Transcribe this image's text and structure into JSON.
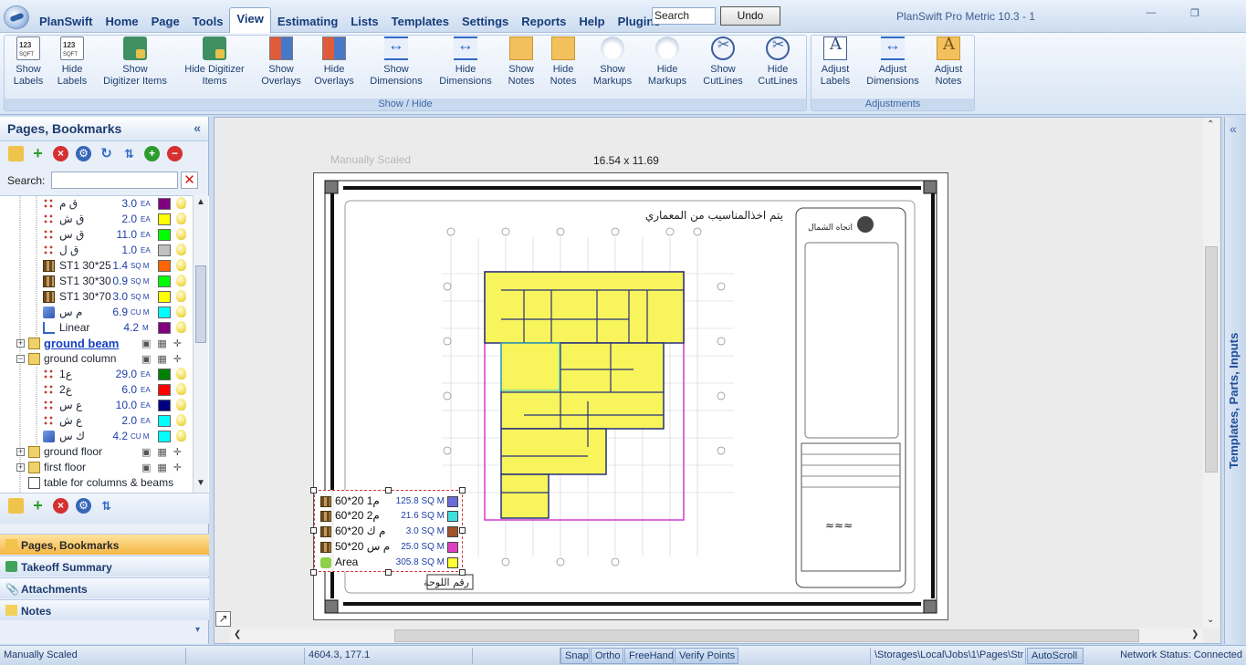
{
  "menubar": {
    "items": [
      "PlanSwift",
      "Home",
      "Page",
      "Tools",
      "View",
      "Estimating",
      "Lists",
      "Templates",
      "Settings",
      "Reports",
      "Help",
      "Plugins"
    ],
    "active_index": 4,
    "search_value": "Search",
    "undo_label": "Undo",
    "window_title": "PlanSwift Pro Metric 10.3 - 1"
  },
  "ribbon": {
    "show_hide_caption": "Show / Hide",
    "adjustments_caption": "Adjustments",
    "buttons": [
      {
        "l1": "Show",
        "l2": "Labels",
        "icon": "show-labels-icon"
      },
      {
        "l1": "Hide",
        "l2": "Labels",
        "icon": "hide-labels-icon"
      },
      {
        "l1": "Show",
        "l2": "Digitizer Items",
        "icon": "show-digitizer-icon"
      },
      {
        "l1": "Hide Digitizer",
        "l2": "Items",
        "icon": "hide-digitizer-icon"
      },
      {
        "l1": "Show",
        "l2": "Overlays",
        "icon": "show-overlays-icon"
      },
      {
        "l1": "Hide",
        "l2": "Overlays",
        "icon": "hide-overlays-icon"
      },
      {
        "l1": "Show",
        "l2": "Dimensions",
        "icon": "show-dimensions-icon"
      },
      {
        "l1": "Hide",
        "l2": "Dimensions",
        "icon": "hide-dimensions-icon"
      },
      {
        "l1": "Show",
        "l2": "Notes",
        "icon": "show-notes-icon"
      },
      {
        "l1": "Hide",
        "l2": "Notes",
        "icon": "hide-notes-icon"
      },
      {
        "l1": "Show",
        "l2": "Markups",
        "icon": "show-markups-icon"
      },
      {
        "l1": "Hide",
        "l2": "Markups",
        "icon": "hide-markups-icon"
      },
      {
        "l1": "Show",
        "l2": "CutLines",
        "icon": "show-cutlines-icon"
      },
      {
        "l1": "Hide",
        "l2": "CutLines",
        "icon": "hide-cutlines-icon"
      },
      {
        "l1": "Adjust",
        "l2": "Labels",
        "icon": "adjust-labels-icon"
      },
      {
        "l1": "Adjust",
        "l2": "Dimensions",
        "icon": "adjust-dimensions-icon"
      },
      {
        "l1": "Adjust",
        "l2": "Notes",
        "icon": "adjust-notes-icon"
      }
    ]
  },
  "left_panel": {
    "title": "Pages, Bookmarks",
    "collapse": "«",
    "search_label": "Search:",
    "tree": [
      {
        "name": "ق م",
        "qty": "3.0",
        "unit": "EA",
        "color": "#800080",
        "icon": "count"
      },
      {
        "name": "ق ش",
        "qty": "2.0",
        "unit": "EA",
        "color": "#ffff00",
        "icon": "count"
      },
      {
        "name": "ق س",
        "qty": "11.0",
        "unit": "EA",
        "color": "#00ff00",
        "icon": "count"
      },
      {
        "name": "ق ل",
        "qty": "1.0",
        "unit": "EA",
        "color": "#c0c0c0",
        "icon": "count"
      },
      {
        "name": "ST1 30*25",
        "qty": "1.4",
        "unit": "SQ M",
        "color": "#ff6600",
        "icon": "area"
      },
      {
        "name": "ST1 30*30",
        "qty": "0.9",
        "unit": "SQ M",
        "color": "#00ff00",
        "icon": "area"
      },
      {
        "name": "ST1 30*70",
        "qty": "3.0",
        "unit": "SQ M",
        "color": "#ffff00",
        "icon": "area"
      },
      {
        "name": "م س",
        "qty": "6.9",
        "unit": "CU M",
        "color": "#00ffff",
        "icon": "volume"
      },
      {
        "name": "Linear",
        "qty": "4.2",
        "unit": "M",
        "color": "#800080",
        "icon": "linear"
      },
      {
        "name": "ground beam",
        "folder": true
      },
      {
        "name": "ground column",
        "folder": true,
        "expanded": true
      },
      {
        "name": "ع1",
        "qty": "29.0",
        "unit": "EA",
        "color": "#008000",
        "icon": "count"
      },
      {
        "name": "ع2",
        "qty": "6.0",
        "unit": "EA",
        "color": "#ff0000",
        "icon": "count"
      },
      {
        "name": "ع س",
        "qty": "10.0",
        "unit": "EA",
        "color": "#000080",
        "icon": "count"
      },
      {
        "name": "ع ش",
        "qty": "2.0",
        "unit": "EA",
        "color": "#00ffff",
        "icon": "count"
      },
      {
        "name": "ك س",
        "qty": "4.2",
        "unit": "CU M",
        "color": "#00ffff",
        "icon": "volume"
      },
      {
        "name": "ground floor",
        "folder": true
      },
      {
        "name": "first floor",
        "folder": true
      },
      {
        "name": "table for columns & beams",
        "page": true
      }
    ],
    "nav": [
      {
        "label": "Pages, Bookmarks",
        "active": true
      },
      {
        "label": "Takeoff Summary"
      },
      {
        "label": "Attachments"
      },
      {
        "label": "Notes"
      }
    ]
  },
  "canvas": {
    "scale_caption": "Manually Scaled",
    "sheet_size": "16.54 x 11.69",
    "drawing_header_text": "يتم اخذالمناسيب  من المعماري",
    "north_label": "اتجاه الشمال",
    "sheet_number_label": "رقم اللوحة",
    "legend": [
      {
        "name": "م1 20*60",
        "value": "125.8 SQ M",
        "color": "#6b6bdc",
        "icon": "area"
      },
      {
        "name": "م2 20*60",
        "value": "21.6 SQ M",
        "color": "#40e0e0",
        "icon": "area"
      },
      {
        "name": "م ك 20*60",
        "value": "3.0 SQ M",
        "color": "#a0522d",
        "icon": "area"
      },
      {
        "name": "م س 20*50",
        "value": "25.0 SQ M",
        "color": "#e040c0",
        "icon": "area"
      },
      {
        "name": "Area",
        "value": "305.8 SQ M",
        "color": "#ffff33",
        "icon": "area-green"
      }
    ]
  },
  "right_dock": {
    "label": "Templates, Parts, Inputs",
    "collapse": "«"
  },
  "statusbar": {
    "scale": "Manually Scaled",
    "coords": "4604.3, 177.1",
    "snap": "Snap",
    "ortho": "Ortho",
    "freehand": "FreeHand",
    "verify": "Verify Points",
    "path": "\\Storages\\Local\\Jobs\\1\\Pages\\Str",
    "autoscroll": "AutoScroll",
    "network": "Network Status: Connected"
  }
}
